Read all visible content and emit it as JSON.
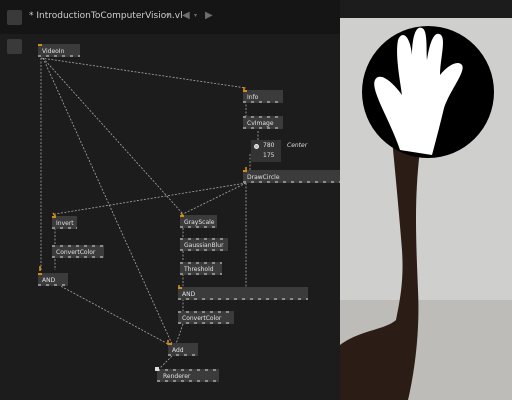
{
  "editor": {
    "title": "* IntroductionToComputerVision.vl",
    "title_caret_icon": "caret-down-icon",
    "nav_back_icon": "arrow-left-icon",
    "nav_forward_icon": "arrow-right-icon"
  },
  "nodes": {
    "videoin": "VideoIn",
    "info": "Info",
    "cvimage": "CvImage",
    "drawcircle": "DrawCircle",
    "invert": "Invert",
    "convertcolor_left": "ConvertColor",
    "and_left": "AND",
    "grayscale": "GrayScale",
    "gaussianblur": "GaussianBlur",
    "threshold": "Threshold",
    "and_main": "AND",
    "convertcolor_right": "ConvertColor",
    "add": "Add",
    "renderer": "Renderer"
  },
  "iobox": {
    "x": "780",
    "y": "175"
  },
  "pad_label": "Center",
  "colors": {
    "accent": "#d28a18",
    "node_bg": "#3b3b3b",
    "wire": "#a9a9a9",
    "background": "#1c1c1c"
  }
}
